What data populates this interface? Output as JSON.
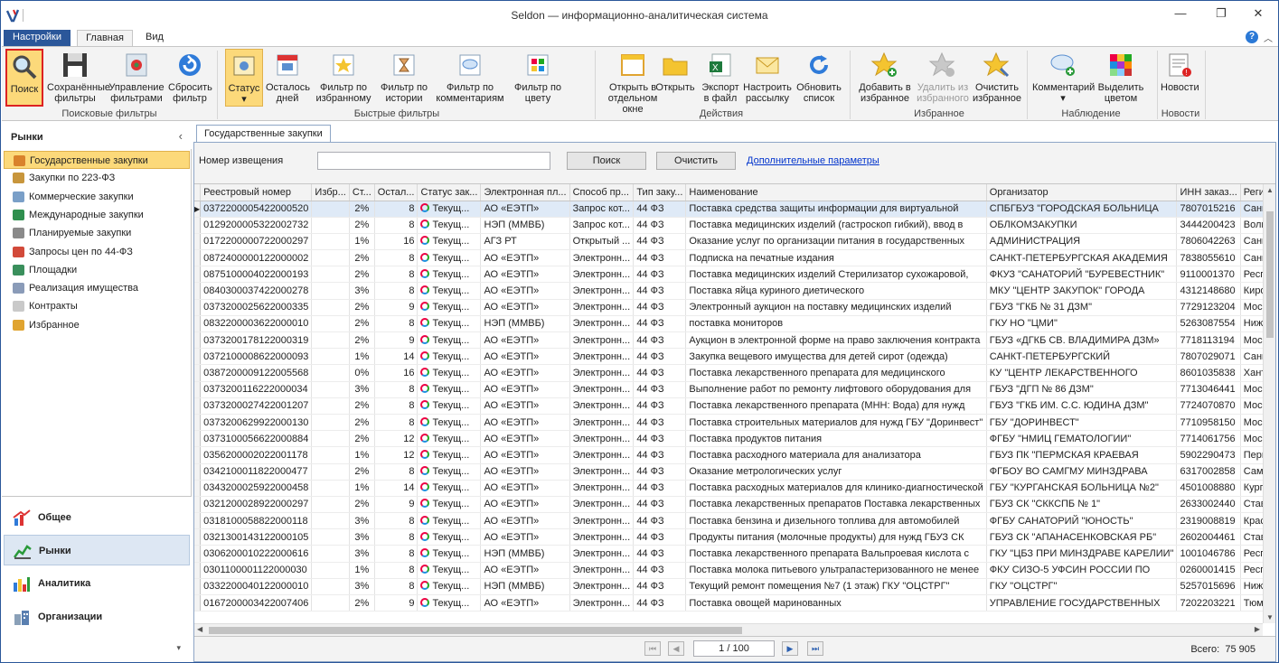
{
  "window": {
    "title": "Seldon — информационно-аналитическая система",
    "min": "—",
    "max": "❐",
    "close": "✕"
  },
  "tabs": {
    "settings": "Настройки",
    "main": "Главная",
    "view": "Вид",
    "help": "?",
    "collapse": "︿"
  },
  "ribbon": {
    "search": {
      "search": "Поиск",
      "saved": "Сохранённые фильтры",
      "manage": "Управление фильтрами",
      "reset": "Сбросить фильтр",
      "group": "Поисковые фильтры"
    },
    "quick": {
      "status": "Статус",
      "left": "Осталось дней",
      "fav": "Фильтр по избранному",
      "history": "Фильтр по истории",
      "comment": "Фильтр по комментариям",
      "color": "Фильтр по цвету",
      "group": "Быстрые фильтры"
    },
    "actions": {
      "open_window": "Открыть в отдельном окне",
      "open": "Открыть",
      "export": "Экспорт в файл",
      "mailing": "Настроить рассылку",
      "refresh": "Обновить список",
      "group": "Действия"
    },
    "favorites": {
      "add": "Добавить в избранное",
      "remove": "Удалить из избранного",
      "clear": "Очистить избранное",
      "group": "Избранное"
    },
    "watch": {
      "comment": "Комментарий",
      "highlight": "Выделить цветом",
      "group": "Наблюдение"
    },
    "news": {
      "news": "Новости",
      "group": "Новости"
    }
  },
  "sidebar": {
    "title": "Рынки",
    "collapse": "‹",
    "items": [
      {
        "label": "Государственные закупки",
        "color": "#d9822b"
      },
      {
        "label": "Закупки по 223-ФЗ",
        "color": "#c8963c"
      },
      {
        "label": "Коммерческие закупки",
        "color": "#7a9fc8"
      },
      {
        "label": "Международные закупки",
        "color": "#2f8f4e"
      },
      {
        "label": "Планируемые закупки",
        "color": "#8a8a8a"
      },
      {
        "label": "Запросы цен по 44-ФЗ",
        "color": "#d24a3a"
      },
      {
        "label": "Площадки",
        "color": "#3a8f5c"
      },
      {
        "label": "Реализация имущества",
        "color": "#8a9bb8"
      },
      {
        "label": "Контракты",
        "color": "#c9c9c9"
      },
      {
        "label": "Избранное",
        "color": "#e0a430"
      }
    ],
    "nav": {
      "general": "Общее",
      "markets": "Рынки",
      "analytics": "Аналитика",
      "orgs": "Организации"
    },
    "more": "▾"
  },
  "document_tab": "Государственные закупки",
  "search": {
    "label": "Номер извещения",
    "value": "",
    "search_btn": "Поиск",
    "clear_btn": "Очистить",
    "advanced": "Дополнительные параметры"
  },
  "table": {
    "columns": [
      "Реестровый номер",
      "Избр...",
      "Ст...",
      "Остал...",
      "Статус зак...",
      "Электронная пл...",
      "Способ пр...",
      "Тип заку...",
      "Наименование",
      "Организатор",
      "ИНН заказ...",
      "Регион заказчи"
    ],
    "rows": [
      [
        "0372200005422000520",
        "",
        "2%",
        "8",
        "Текущ...",
        "АО «ЕЭТП»",
        "Запрос кот...",
        "44 ФЗ",
        "Поставка средства защиты информации для виртуальной",
        "СПБГБУЗ \"ГОРОДСКАЯ БОЛЬНИЦА",
        "7807015216",
        "Санкт-Петербу"
      ],
      [
        "0129200005322002732",
        "",
        "2%",
        "8",
        "Текущ...",
        "НЭП (ММВБ)",
        "Запрос кот...",
        "44 ФЗ",
        "Поставка медицинских изделий (гастроскоп гибкий), ввод в",
        "ОБЛКОМЗАКУПКИ",
        "3444200423",
        "Волгоградская"
      ],
      [
        "0172200000722000297",
        "",
        "1%",
        "16",
        "Текущ...",
        "АГЗ РТ",
        "Открытый ...",
        "44 ФЗ",
        "Оказание услуг по организации питания в государственных",
        "АДМИНИСТРАЦИЯ",
        "7806042263",
        "Санкт-Петербу"
      ],
      [
        "0872400000122000002",
        "",
        "2%",
        "8",
        "Текущ...",
        "АО «ЕЭТП»",
        "Электронн...",
        "44 ФЗ",
        "Подписка на печатные издания",
        "САНКТ-ПЕТЕРБУРГСКАЯ АКАДЕМИЯ",
        "7838055610",
        "Санкт-Петербу"
      ],
      [
        "0875100004022000193",
        "",
        "2%",
        "8",
        "Текущ...",
        "АО «ЕЭТП»",
        "Электронн...",
        "44 ФЗ",
        "Поставка медицинских изделий Стерилизатор сухожаровой,",
        "ФКУЗ \"САНАТОРИЙ \"БУРЕВЕСТНИК\"",
        "9110001370",
        "Республика Кр"
      ],
      [
        "0840300037422000278",
        "",
        "3%",
        "8",
        "Текущ...",
        "АО «ЕЭТП»",
        "Электронн...",
        "44 ФЗ",
        "Поставка яйца куриного диетического",
        "МКУ \"ЦЕНТР ЗАКУПОК\" ГОРОДА",
        "4312148680",
        "Кировская обл"
      ],
      [
        "0373200025622000335",
        "",
        "2%",
        "9",
        "Текущ...",
        "АО «ЕЭТП»",
        "Электронн...",
        "44 ФЗ",
        "Электронный аукцион на поставку медицинских изделий",
        "ГБУЗ \"ГКБ № 31 ДЗМ\"",
        "7729123204",
        "Москва"
      ],
      [
        "0832200003622000010",
        "",
        "2%",
        "8",
        "Текущ...",
        "НЭП (ММВБ)",
        "Электронн...",
        "44 ФЗ",
        "поставка мониторов",
        "ГКУ НО \"ЦМИ\"",
        "5263087554",
        "Нижегородская"
      ],
      [
        "0373200178122000319",
        "",
        "2%",
        "9",
        "Текущ...",
        "АО «ЕЭТП»",
        "Электронн...",
        "44 ФЗ",
        "Аукцион в электронной форме на право заключения контракта",
        "ГБУЗ «ДГКБ СВ. ВЛАДИМИРА ДЗМ»",
        "7718113194",
        "Москва"
      ],
      [
        "0372100008622000093",
        "",
        "1%",
        "14",
        "Текущ...",
        "АО «ЕЭТП»",
        "Электронн...",
        "44 ФЗ",
        "Закупка вещевого имущества для детей сирот (одежда)",
        "САНКТ-ПЕТЕРБУРГСКИЙ",
        "7807029071",
        "Санкт-Петербу"
      ],
      [
        "0387200009122005568",
        "",
        "0%",
        "16",
        "Текущ...",
        "АО «ЕЭТП»",
        "Электронн...",
        "44 ФЗ",
        "Поставка лекарственного препарата для медицинского",
        "КУ \"ЦЕНТР ЛЕКАРСТВЕННОГО",
        "8601035838",
        "Ханты-Мансийс"
      ],
      [
        "0373200116222000034",
        "",
        "3%",
        "8",
        "Текущ...",
        "АО «ЕЭТП»",
        "Электронн...",
        "44 ФЗ",
        "Выполнение работ по ремонту лифтового оборудования для",
        "ГБУЗ \"ДГП № 86 ДЗМ\"",
        "7713046441",
        "Москва"
      ],
      [
        "0373200027422001207",
        "",
        "2%",
        "8",
        "Текущ...",
        "АО «ЕЭТП»",
        "Электронн...",
        "44 ФЗ",
        "Поставка лекарственного препарата (МНН: Вода) для нужд",
        "ГБУЗ \"ГКБ ИМ. С.С. ЮДИНА ДЗМ\"",
        "7724070870",
        "Москва"
      ],
      [
        "0373200629922000130",
        "",
        "2%",
        "8",
        "Текущ...",
        "АО «ЕЭТП»",
        "Электронн...",
        "44 ФЗ",
        "Поставка строительных материалов для нужд ГБУ \"Доринвест\"",
        "ГБУ \"ДОРИНВЕСТ\"",
        "7710958150",
        "Москва"
      ],
      [
        "0373100056622000884",
        "",
        "2%",
        "12",
        "Текущ...",
        "АО «ЕЭТП»",
        "Электронн...",
        "44 ФЗ",
        "Поставка продуктов питания",
        "ФГБУ \"НМИЦ ГЕМАТОЛОГИИ\"",
        "7714061756",
        "Москва"
      ],
      [
        "0356200002022001178",
        "",
        "1%",
        "12",
        "Текущ...",
        "АО «ЕЭТП»",
        "Электронн...",
        "44 ФЗ",
        "Поставка расходного материала для анализатора",
        "ГБУЗ ПК \"ПЕРМСКАЯ КРАЕВАЯ",
        "5902290473",
        "Пермский край"
      ],
      [
        "0342100011822000477",
        "",
        "2%",
        "8",
        "Текущ...",
        "АО «ЕЭТП»",
        "Электронн...",
        "44 ФЗ",
        "Оказание метрологических услуг",
        "ФГБОУ ВО САМГМУ МИНЗДРАВА",
        "6317002858",
        "Самарская обл"
      ],
      [
        "0343200025922000458",
        "",
        "1%",
        "14",
        "Текущ...",
        "АО «ЕЭТП»",
        "Электронн...",
        "44 ФЗ",
        "Поставка расходных материалов для клинико-диагностической",
        "ГБУ \"КУРГАНСКАЯ БОЛЬНИЦА №2\"",
        "4501008880",
        "Курганская обл"
      ],
      [
        "0321200028922000297",
        "",
        "2%",
        "9",
        "Текущ...",
        "АО «ЕЭТП»",
        "Электронн...",
        "44 ФЗ",
        "Поставка лекарственных препаратов Поставка лекарственных",
        "ГБУЗ СК \"СККСПБ № 1\"",
        "2633002440",
        "Ставропольски"
      ],
      [
        "0318100058822000118",
        "",
        "3%",
        "8",
        "Текущ...",
        "АО «ЕЭТП»",
        "Электронн...",
        "44 ФЗ",
        "Поставка бензина и дизельного топлива для автомобилей",
        "ФГБУ САНАТОРИЙ \"ЮНОСТЬ\"",
        "2319008819",
        "Краснодарский"
      ],
      [
        "0321300143122000105",
        "",
        "3%",
        "8",
        "Текущ...",
        "АО «ЕЭТП»",
        "Электронн...",
        "44 ФЗ",
        "Продукты питания (молочные продукты) для нужд ГБУЗ СК",
        "ГБУЗ СК \"АПАНАСЕНКОВСКАЯ РБ\"",
        "2602004461",
        "Ставропольски"
      ],
      [
        "0306200010222000616",
        "",
        "3%",
        "8",
        "Текущ...",
        "НЭП (ММВБ)",
        "Электронн...",
        "44 ФЗ",
        "Поставка лекарственного препарата Вальпроевая кислота с",
        "ГКУ \"ЦБЗ ПРИ МИНЗДРАВЕ КАРЕЛИИ\"",
        "1001046786",
        "Республика Ка"
      ],
      [
        "0301100001122000030",
        "",
        "1%",
        "8",
        "Текущ...",
        "АО «ЕЭТП»",
        "Электронн...",
        "44 ФЗ",
        "Поставка молока питьевого ультрапастеризованного не менее",
        "ФКУ СИЗО-5 УФСИН РОССИИ ПО",
        "0260001415",
        "Республика Ба"
      ],
      [
        "0332200040122000010",
        "",
        "3%",
        "8",
        "Текущ...",
        "НЭП (ММВБ)",
        "Электронн...",
        "44 ФЗ",
        "Текущий ремонт помещения №7 (1 этаж) ГКУ \"ОЦСТРГ\"",
        "ГКУ \"ОЦСТРГ\"",
        "5257015696",
        "Нижегородская"
      ],
      [
        "0167200003422007406",
        "",
        "2%",
        "9",
        "Текущ...",
        "АО «ЕЭТП»",
        "Электронн...",
        "44 ФЗ",
        "Поставка овощей маринованных",
        "УПРАВЛЕНИЕ ГОСУДАРСТВЕННЫХ",
        "7202203221",
        "Тюменская обл"
      ]
    ]
  },
  "pager": {
    "first": "⏮",
    "prev": "◀",
    "page": "1 / 100",
    "next": "▶",
    "last": "⏭",
    "total_label": "Всего:",
    "total_value": "75 905"
  }
}
